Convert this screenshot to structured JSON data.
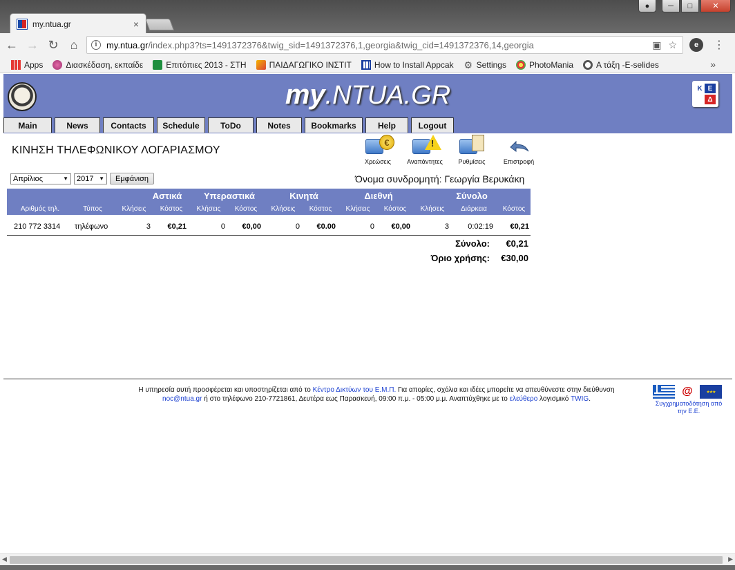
{
  "browser": {
    "tab_title": "my.ntua.gr",
    "tab_close": "×",
    "url_host": "my.ntua.gr",
    "url_path": "/index.php3?ts=1491372376&twig_sid=1491372376,1,georgia&twig_cid=1491372376,14,georgia",
    "bookmarks": [
      {
        "label": "Apps",
        "icon": "apps-grid-icon"
      },
      {
        "label": "Διασκέδαση, εκπαίδε",
        "icon": "flower-icon"
      },
      {
        "label": "Επιτόπιες 2013 - ΣΤΗ",
        "icon": "sheets-icon"
      },
      {
        "label": "ΠΑΙΔΑΓΩΓΙΚΟ ΙΝΣΤΙΤ",
        "icon": "pencil-icon"
      },
      {
        "label": "How to Install Appcak",
        "icon": "grid-icon"
      },
      {
        "label": "Settings",
        "icon": "gear-icon"
      },
      {
        "label": "PhotoMania",
        "icon": "flower-icon"
      },
      {
        "label": "A τάξη -E-selides",
        "icon": "face-icon"
      }
    ],
    "more_bookmarks": "»"
  },
  "site": {
    "title_my": "my",
    "title_rest": ".NTUA.GR",
    "logo_right": {
      "k": "Κ",
      "e": "Ε",
      "d": "Δ"
    },
    "menu": [
      "Main",
      "News",
      "Contacts",
      "Schedule",
      "ToDo",
      "Notes",
      "Bookmarks",
      "Help",
      "Logout"
    ]
  },
  "content": {
    "title": "ΚΙΝΗΣΗ ΤΗΛΕΦΩΝΙΚΟΥ ΛΟΓΑΡΙΑΣΜΟΥ",
    "actions": [
      {
        "label": "Χρεώσεις",
        "icon": "phone-euro-icon"
      },
      {
        "label": "Αναπάντητες",
        "icon": "phone-warning-icon"
      },
      {
        "label": "Ρυθμίσεις",
        "icon": "phone-settings-icon"
      },
      {
        "label": "Επιστροφή",
        "icon": "back-arrow-icon"
      }
    ],
    "month_value": "Απρίλιος",
    "year_value": "2017",
    "show_button": "Εμφάνιση",
    "subscriber": "Όνομα συνδρομητή: Γεωργία Βερυκάκη"
  },
  "table": {
    "groups": [
      "Αστικά",
      "Υπεραστικά",
      "Κινητά",
      "Διεθνή",
      "Σύνολο"
    ],
    "columns": [
      "Αριθμός τηλ.",
      "Τύπος",
      "Κλήσεις",
      "Κόστος",
      "Κλήσεις",
      "Κόστος",
      "Κλήσεις",
      "Κόστος",
      "Κλήσεις",
      "Κόστος",
      "Κλήσεις",
      "Διάρκεια",
      "Κόστος"
    ],
    "rows": [
      [
        "210 772 3314",
        "τηλέφωνο",
        "3",
        "€0,21",
        "0",
        "€0,00",
        "0",
        "€0.00",
        "0",
        "€0,00",
        "3",
        "0:02:19",
        "€0,21"
      ]
    ],
    "total_label": "Σύνολο:",
    "total_value": "€0,21",
    "limit_label": "Όριο χρήσης:",
    "limit_value": "€30,00"
  },
  "footer": {
    "t1": "Η υπηρεσία αυτή προσφέρεται και υποστηρίζεται από το ",
    "l1": "Κέντρο Δικτύων του Ε.Μ.Π.",
    "t2": " Για απορίες, σχόλια και ιδέες μπορείτε να απευθύνεστε στην διεύθυνση",
    "l2": "noc@ntua.gr",
    "t3": " ή στο τηλέφωνο 210-7721861, Δευτέρα εως Παρασκευή, 09:00 π.μ. - 05:00 μ.μ. Αναπτύχθηκε με το ",
    "l3": "ελεύθερο",
    "t4": " λογισμικό ",
    "l4": "TWIG",
    "t5": ".",
    "eu_caption": "Συγχρηματοδότηση από την Ε.Ε."
  }
}
